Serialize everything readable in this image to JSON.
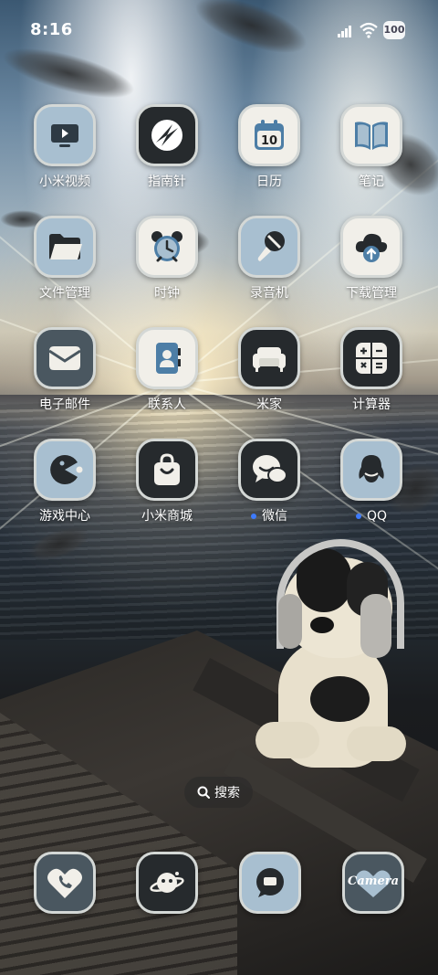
{
  "status_bar": {
    "time": "8:16",
    "battery": "100",
    "icons": [
      "signal-icon",
      "wifi-icon",
      "battery-icon"
    ]
  },
  "apps": [
    {
      "label": "小米视频",
      "icon": "tv-play-icon"
    },
    {
      "label": "指南针",
      "icon": "compass-icon"
    },
    {
      "label": "日历",
      "icon": "calendar-icon",
      "badge": "10"
    },
    {
      "label": "笔记",
      "icon": "notebook-icon"
    },
    {
      "label": "文件管理",
      "icon": "folder-icon"
    },
    {
      "label": "时钟",
      "icon": "alarm-clock-icon"
    },
    {
      "label": "录音机",
      "icon": "microphone-icon"
    },
    {
      "label": "下载管理",
      "icon": "cloud-download-icon"
    },
    {
      "label": "电子邮件",
      "icon": "mail-icon"
    },
    {
      "label": "联系人",
      "icon": "contacts-book-icon"
    },
    {
      "label": "米家",
      "icon": "sofa-icon"
    },
    {
      "label": "计算器",
      "icon": "calculator-icon"
    },
    {
      "label": "游戏中心",
      "icon": "pacman-icon"
    },
    {
      "label": "小米商城",
      "icon": "shopping-bag-icon"
    },
    {
      "label": "微信",
      "icon": "chat-bubbles-icon",
      "new_dot": true
    },
    {
      "label": "QQ",
      "icon": "penguin-icon",
      "new_dot": true
    }
  ],
  "search": {
    "label": "搜索",
    "icon": "search-icon"
  },
  "dock": [
    {
      "name": "phone",
      "icon": "phone-icon"
    },
    {
      "name": "browser",
      "icon": "planet-icon"
    },
    {
      "name": "messages",
      "icon": "message-icon"
    },
    {
      "name": "camera",
      "icon": "camera-icon",
      "text": "Camera"
    }
  ],
  "colors": {
    "dot": "#3d7bff",
    "icon_border": "#d4d8d6",
    "icon_blue": "#a8bfd0"
  }
}
